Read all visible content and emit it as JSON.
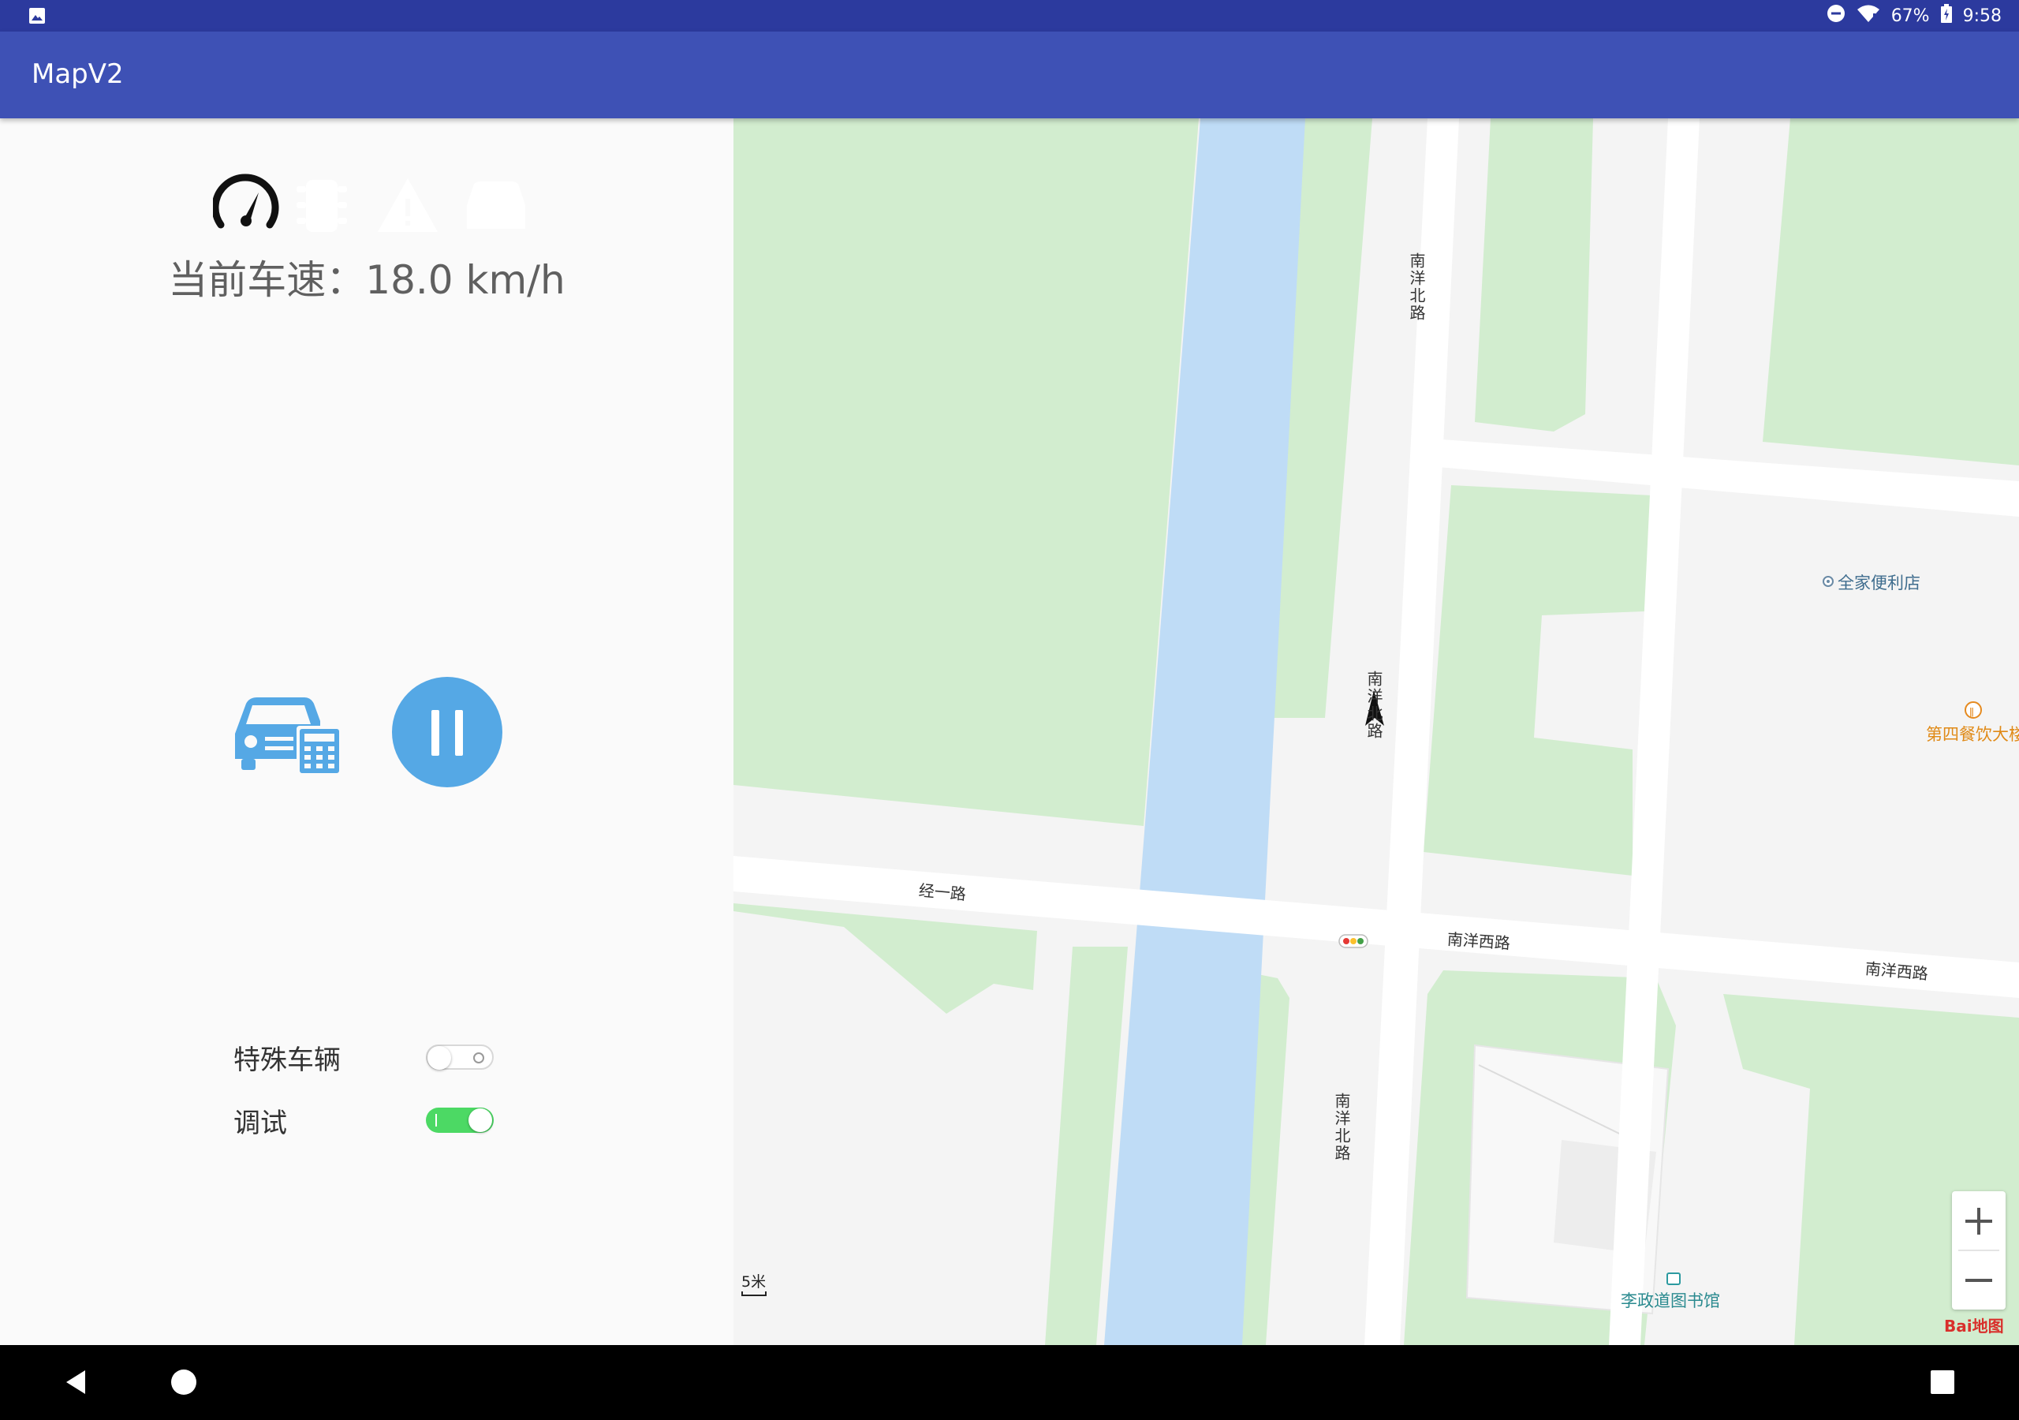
{
  "status_bar": {
    "battery_percent": "67%",
    "time": "9:58",
    "icons": [
      "image-notification-icon",
      "do-not-disturb-icon",
      "wifi-icon",
      "battery-charging-icon"
    ]
  },
  "app_bar": {
    "title": "MapV2"
  },
  "left_panel": {
    "status_icons": [
      "speedometer-icon",
      "traffic-light-icon",
      "warning-icon",
      "car-icon"
    ],
    "speed_text": "当前车速：18.0 km/h",
    "settings": [
      {
        "label": "特殊车辆",
        "enabled": false
      },
      {
        "label": "调试",
        "enabled": true
      }
    ]
  },
  "map": {
    "road_labels": {
      "nanyang_north_top": "南洋北路",
      "nanyang_north_mid": "南洋北路",
      "nanyang_north_bottom": "南洋北路",
      "jingyi": "经一路",
      "nanyang_west_1": "南洋西路",
      "nanyang_west_2": "南洋西路"
    },
    "pois": {
      "family_mart": "全家便利店",
      "canteen": "第四餐饮大楼",
      "library": "李政道图书馆"
    },
    "scale": "5米",
    "logo": "Bai地图",
    "colors": {
      "water": "#bfdcf6",
      "green": "#d2edcf",
      "road": "#ffffff",
      "block": "#f4f4f4"
    }
  },
  "colors": {
    "accent": "#3e51b5",
    "status_bar": "#2c3a9e",
    "button_blue": "#55a8e5",
    "toggle_on": "#4cd964"
  }
}
